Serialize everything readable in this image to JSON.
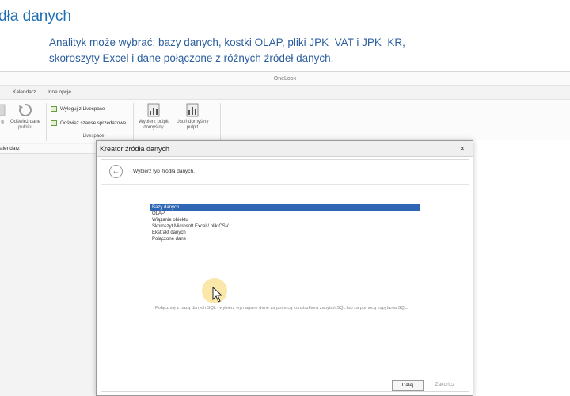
{
  "slide": {
    "title": "dła danych",
    "text_line1": "Analityk może wybrać: bazy danych, kostki OLAP, pliki JPK_VAT i JPK_KR,",
    "text_line2": "skoroszyty Excel i dane połączone z różnych źródeł danych."
  },
  "app": {
    "title": "OneLook",
    "menu": [
      "Kalendarz",
      "Inne opcje"
    ],
    "ribbon": {
      "btn_partial_label": "g",
      "refresh_dashboard": "Odśwież dane pulpitu",
      "logout_livespace": "Wyloguj z Livespace",
      "refresh_sales": "Odśwież szanse sprzedażowe",
      "livespace_group": "Livespace",
      "choose_default": "Wybierz pulpit domyślny",
      "remove_default": "Usuń domyślny pulpit"
    },
    "subbar": "alendarz"
  },
  "dialog": {
    "title": "Kreator źródła danych",
    "close": "×",
    "step_label": "Wybierz typ źródła danych.",
    "options": [
      "Bazy danych",
      "OLAP",
      "Wiązanie obiektu",
      "Skoroszyt Microsoft Excel / plik CSV",
      "Ekstrakt danych",
      "Połączone dane"
    ],
    "selected_index": 0,
    "description": "Połącz się z bazą danych SQL i wybierz wymagane dane za pomocą konstruktora zapytań SQL lub za pomocą zapytania SQL.",
    "next_button": "Dalej",
    "finish_button": "Zakończ"
  },
  "colors": {
    "accent_blue": "#2f66b3",
    "slide_title": "#1f6fb5",
    "cursor_highlight": "#f5d462"
  }
}
